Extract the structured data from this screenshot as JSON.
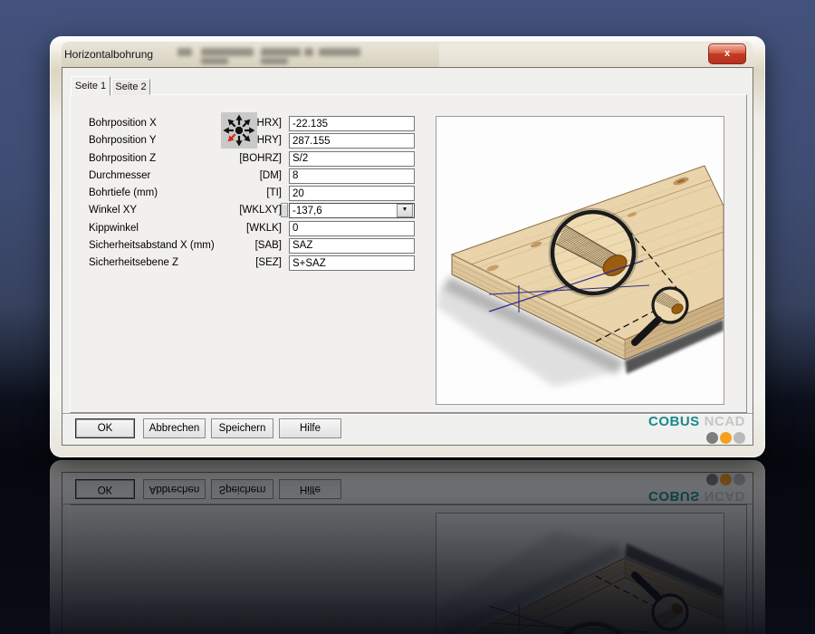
{
  "window": {
    "title": "Horizontalbohrung"
  },
  "icons": {
    "close": "x",
    "dropdown": "▼",
    "move_cursor": "move-cursor-8-arrows-red-sw"
  },
  "tabs": [
    {
      "label": "Seite 1",
      "active": true
    },
    {
      "label": "Seite 2",
      "active": false
    }
  ],
  "form": {
    "rows": [
      {
        "key": "bohrx",
        "label": "Bohrposition X",
        "code": "[BOHRX]",
        "value": "-22.135",
        "type": "input"
      },
      {
        "key": "bohry",
        "label": "Bohrposition Y",
        "code": "[BOHRY]",
        "value": "287.155",
        "type": "input"
      },
      {
        "key": "bohrz",
        "label": "Bohrposition Z",
        "code": "[BOHRZ]",
        "value": "S/2",
        "type": "input"
      },
      {
        "key": "dm",
        "label": "Durchmesser",
        "code": "[DM]",
        "value": "8",
        "type": "input"
      },
      {
        "key": "ti",
        "label": "Bohrtiefe (mm)",
        "code": "[TI]",
        "value": "20",
        "type": "input"
      },
      {
        "key": "wklxy",
        "label": "Winkel XY",
        "code": "[WKLXY]",
        "value": "-137,6",
        "type": "combo"
      },
      {
        "key": "wklk",
        "label": "Kippwinkel",
        "code": "[WKLK]",
        "value": "0",
        "type": "input"
      },
      {
        "key": "sab",
        "label": "Sicherheitsabstand X (mm)",
        "code": "[SAB]",
        "value": "SAZ",
        "type": "input"
      },
      {
        "key": "sez",
        "label": "Sicherheitsebene Z",
        "code": "[SEZ]",
        "value": "S+SAZ",
        "type": "input"
      }
    ]
  },
  "buttons": [
    {
      "key": "ok",
      "label": "OK",
      "default": true
    },
    {
      "key": "abbrechen",
      "label": "Abbrechen",
      "default": false
    },
    {
      "key": "speichern",
      "label": "Speichern",
      "default": false
    },
    {
      "key": "hilfe",
      "label": "Hilfe",
      "default": false
    }
  ],
  "brand": {
    "primary": "COBUS",
    "secondary": "NCAD",
    "colors": {
      "primary": "#17898c",
      "secondary": "#c6c6c6",
      "dots": [
        "#7d7d7d",
        "#f5a11d",
        "#b9b9b9"
      ]
    }
  },
  "preview": {
    "image_name": "wood-board-horizontal-drill-magnifier-illustration"
  }
}
